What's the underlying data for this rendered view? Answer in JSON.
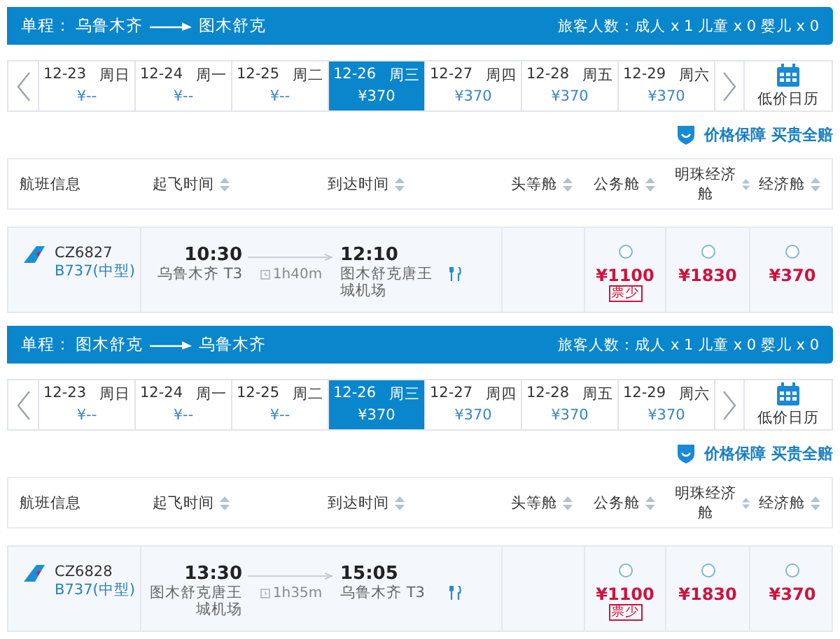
{
  "segments": [
    {
      "trip_label": "单程：",
      "from": "乌鲁木齐",
      "to": "图木舒克",
      "passengers": "旅客人数：成人 x 1 儿童 x 0 婴儿 x 0",
      "dates": [
        {
          "date": "12-23",
          "weekday": "周日",
          "price": "¥--",
          "selected": false
        },
        {
          "date": "12-24",
          "weekday": "周一",
          "price": "¥--",
          "selected": false
        },
        {
          "date": "12-25",
          "weekday": "周二",
          "price": "¥--",
          "selected": false
        },
        {
          "date": "12-26",
          "weekday": "周三",
          "price": "¥370",
          "selected": true
        },
        {
          "date": "12-27",
          "weekday": "周四",
          "price": "¥370",
          "selected": false
        },
        {
          "date": "12-28",
          "weekday": "周五",
          "price": "¥370",
          "selected": false
        },
        {
          "date": "12-29",
          "weekday": "周六",
          "price": "¥370",
          "selected": false
        }
      ],
      "calendar_label": "低价日历",
      "guarantee": "价格保障 买贵全赔",
      "columns": [
        {
          "label": "航班信息",
          "sortable": false
        },
        {
          "label": "起飞时间",
          "sortable": true
        },
        {
          "label": "到达时间",
          "sortable": true
        },
        {
          "label": "头等舱",
          "sortable": true
        },
        {
          "label": "公务舱",
          "sortable": true
        },
        {
          "label": "明珠经济舱",
          "sortable": true
        },
        {
          "label": "经济舱",
          "sortable": true
        }
      ],
      "flights": [
        {
          "flight_no": "CZ6827",
          "aircraft": "B737(中型)",
          "depart_time": "10:30",
          "depart_airport": "乌鲁木齐 T3",
          "duration": "1h40m",
          "arrive_time": "12:10",
          "arrive_airport": "图木舒克唐王城机场",
          "meal": true,
          "fares": [
            {
              "kind": "empty"
            },
            {
              "kind": "fare",
              "price": "¥1100",
              "tag": "票少",
              "selected": false
            },
            {
              "kind": "fare",
              "price": "¥1830",
              "selected": false
            },
            {
              "kind": "fare",
              "price": "¥370",
              "selected": false
            }
          ]
        }
      ]
    },
    {
      "trip_label": "单程：",
      "from": "图木舒克",
      "to": "乌鲁木齐",
      "passengers": "旅客人数：成人 x 1 儿童 x 0 婴儿 x 0",
      "dates": [
        {
          "date": "12-23",
          "weekday": "周日",
          "price": "¥--",
          "selected": false
        },
        {
          "date": "12-24",
          "weekday": "周一",
          "price": "¥--",
          "selected": false
        },
        {
          "date": "12-25",
          "weekday": "周二",
          "price": "¥--",
          "selected": false
        },
        {
          "date": "12-26",
          "weekday": "周三",
          "price": "¥370",
          "selected": true
        },
        {
          "date": "12-27",
          "weekday": "周四",
          "price": "¥370",
          "selected": false
        },
        {
          "date": "12-28",
          "weekday": "周五",
          "price": "¥370",
          "selected": false
        },
        {
          "date": "12-29",
          "weekday": "周六",
          "price": "¥370",
          "selected": false
        }
      ],
      "calendar_label": "低价日历",
      "guarantee": "价格保障 买贵全赔",
      "columns": [
        {
          "label": "航班信息",
          "sortable": false
        },
        {
          "label": "起飞时间",
          "sortable": true
        },
        {
          "label": "到达时间",
          "sortable": true
        },
        {
          "label": "头等舱",
          "sortable": true
        },
        {
          "label": "公务舱",
          "sortable": true
        },
        {
          "label": "明珠经济舱",
          "sortable": true
        },
        {
          "label": "经济舱",
          "sortable": true
        }
      ],
      "flights": [
        {
          "flight_no": "CZ6828",
          "aircraft": "B737(中型)",
          "depart_time": "13:30",
          "depart_airport": "图木舒克唐王城机场",
          "duration": "1h35m",
          "arrive_time": "15:05",
          "arrive_airport": "乌鲁木齐 T3",
          "meal": true,
          "fares": [
            {
              "kind": "empty"
            },
            {
              "kind": "fare",
              "price": "¥1100",
              "tag": "票少",
              "selected": false
            },
            {
              "kind": "fare",
              "price": "¥1830",
              "selected": false
            },
            {
              "kind": "fare",
              "price": "¥370",
              "selected": false
            }
          ]
        }
      ]
    }
  ]
}
